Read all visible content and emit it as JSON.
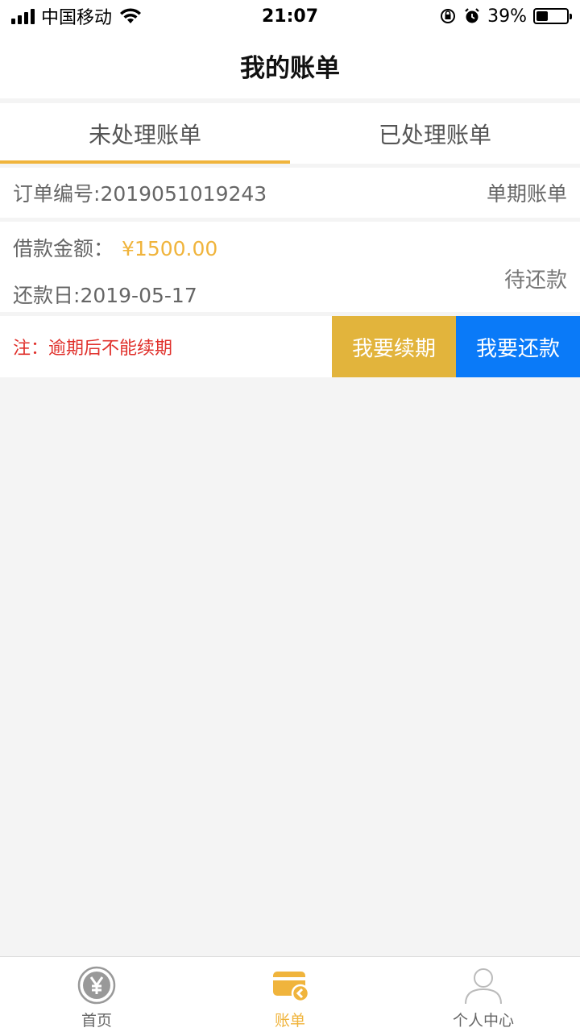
{
  "status_bar": {
    "carrier": "中国移动",
    "time": "21:07",
    "battery_percent": "39%",
    "battery_level": 0.39
  },
  "nav": {
    "title": "我的账单"
  },
  "tabs": [
    {
      "label": "未处理账单",
      "active": true
    },
    {
      "label": "已处理账单",
      "active": false
    }
  ],
  "bill": {
    "order_label": "订单编号:",
    "order_number": "2019051019243",
    "bill_type": "单期账单",
    "amount_label": "借款金额：",
    "amount": "¥1500.00",
    "due_label": "还款日:",
    "due_date": "2019-05-17",
    "status": "待还款",
    "note": "注：逾期后不能续期",
    "renew_button": "我要续期",
    "repay_button": "我要还款"
  },
  "tab_bar": [
    {
      "label": "首页",
      "icon": "yen-circle-icon",
      "active": false
    },
    {
      "label": "账单",
      "icon": "bill-wallet-icon",
      "active": true
    },
    {
      "label": "个人中心",
      "icon": "person-icon",
      "active": false
    }
  ],
  "colors": {
    "accent": "#f0b43c",
    "renew": "#e2b43c",
    "repay": "#0a7af8",
    "note": "#e0302b"
  }
}
